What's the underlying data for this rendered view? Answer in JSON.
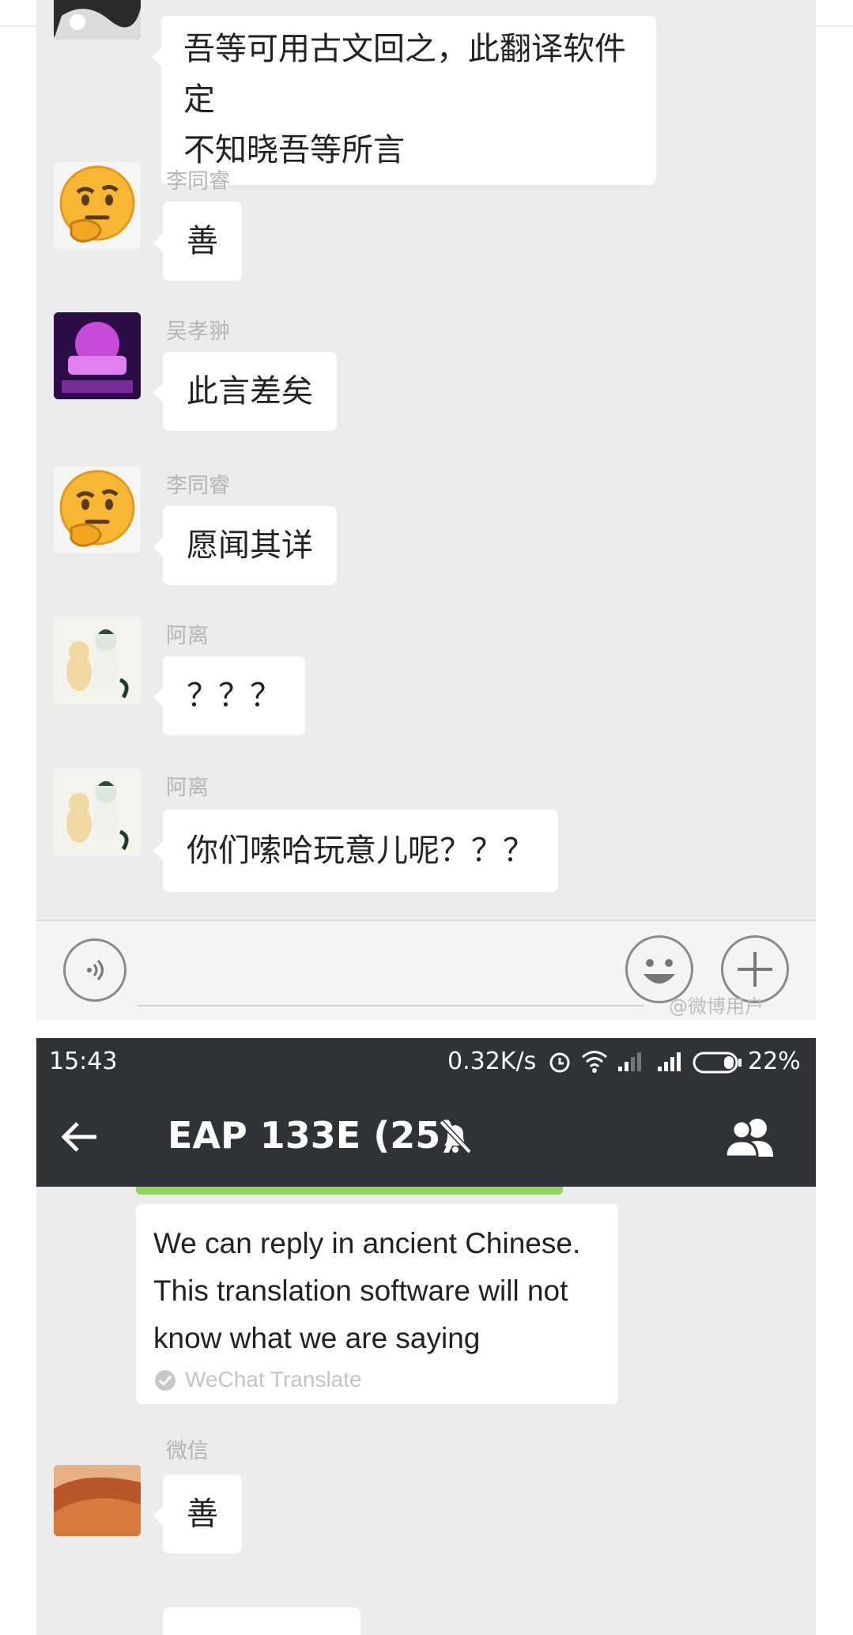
{
  "screenshot1": {
    "messages": [
      {
        "sender": "",
        "text": "吾等可用古文回之，此翻译软件定",
        "text2": "不知晓吾等所言"
      },
      {
        "sender": "李同睿",
        "text": "善"
      },
      {
        "sender": "吴孝翀",
        "text": "此言差矣"
      },
      {
        "sender": "李同睿",
        "text": "愿闻其详"
      },
      {
        "sender": "阿离",
        "text": "？？？"
      },
      {
        "sender": "阿离",
        "text": "你们嗦哈玩意儿呢？？？"
      }
    ],
    "watermark": "@微博用户"
  },
  "screenshot2": {
    "status": {
      "time": "15:43",
      "speed": "0.32K/s",
      "battery": "22%"
    },
    "nav": {
      "title": "EAP 133E (25)"
    },
    "translation": {
      "line1": "We can reply in ancient Chinese.",
      "line2": "This translation software will not",
      "line3": "know what we are saying",
      "label": "WeChat Translate"
    },
    "messages": [
      {
        "sender": "微信",
        "text": "善"
      }
    ]
  },
  "colors": {
    "chat_bg": "#ececec",
    "bar_bg": "#2f3237",
    "bubble": "#ffffff",
    "accent_green": "#8fd45c"
  }
}
